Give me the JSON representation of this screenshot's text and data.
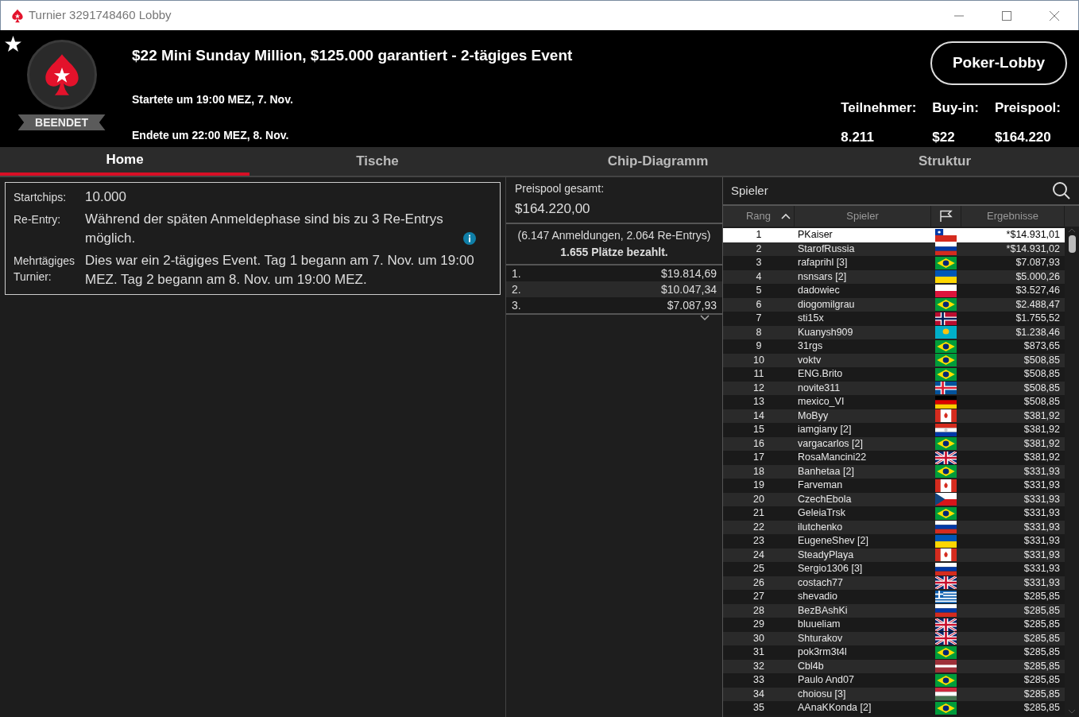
{
  "window": {
    "title": "Turnier 3291748460 Lobby"
  },
  "header": {
    "status": "BEENDET",
    "title": "$22 Mini Sunday Million, $125.000 garantiert - 2-tägiges Event",
    "started": "Startete um 19:00 MEZ, 7. Nov.",
    "ended": "Endete um 22:00 MEZ, 8. Nov.",
    "button": "Poker-Lobby",
    "stats": [
      {
        "label": "Teilnehmer:",
        "value": "8.211"
      },
      {
        "label": "Buy-in:",
        "value": "$22"
      },
      {
        "label": "Preispool:",
        "value": "$164.220"
      }
    ]
  },
  "tabs": [
    {
      "label": "Home",
      "selected": true
    },
    {
      "label": "Tische",
      "selected": false
    },
    {
      "label": "Chip-Diagramm",
      "selected": false
    },
    {
      "label": "Struktur",
      "selected": false
    }
  ],
  "details": [
    {
      "label": "Startchips:",
      "value": "10.000",
      "info": false
    },
    {
      "label": "Re-Entry:",
      "value": "Während der späten Anmeldephase sind bis zu 3 Re-Entrys möglich.",
      "info": true
    },
    {
      "label": "Mehrtägiges Turnier:",
      "value": "Dies war ein 2-tägiges Event. Tag 1 begann am 7. Nov. um 19:00 MEZ. Tag 2 begann am 8. Nov. um 19:00 MEZ.",
      "info": false
    }
  ],
  "prizepool": {
    "label": "Preispool gesamt:",
    "value": "$164.220,00",
    "entries": "(6.147 Anmeldungen, 2.064 Re-Entrys)",
    "paid": "1.655 Plätze bezahlt.",
    "payouts": [
      {
        "place": "1.",
        "amount": "$19.814,69"
      },
      {
        "place": "2.",
        "amount": "$10.047,34"
      },
      {
        "place": "3.",
        "amount": "$7.087,93"
      }
    ]
  },
  "players": {
    "title": "Spieler",
    "columns": [
      {
        "label": "Rang",
        "sorted": true
      },
      {
        "label": "Spieler",
        "sorted": false
      },
      {
        "label": "Ergebnisse",
        "sorted": false
      }
    ],
    "rows": [
      {
        "rank": "1",
        "name": "PKaiser",
        "kind": "cl",
        "result": "*$14.931,01",
        "selected": true
      },
      {
        "rank": "2",
        "name": "StarofRussia",
        "kind": "ru",
        "result": "*$14.931,02",
        "selected": false
      },
      {
        "rank": "3",
        "name": "rafaprihl [3]",
        "kind": "br",
        "result": "$7.087,93",
        "selected": false
      },
      {
        "rank": "4",
        "name": "nsnsars [2]",
        "kind": "ua",
        "result": "$5.000,26",
        "selected": false
      },
      {
        "rank": "5",
        "name": "dadowiec",
        "kind": "pl",
        "result": "$3.527,46",
        "selected": false
      },
      {
        "rank": "6",
        "name": "diogomilgrau",
        "kind": "br",
        "result": "$2.488,47",
        "selected": false
      },
      {
        "rank": "7",
        "name": "sti15x",
        "kind": "no",
        "result": "$1.755,52",
        "selected": false
      },
      {
        "rank": "8",
        "name": "Kuanysh909",
        "kind": "kz",
        "result": "$1.238,46",
        "selected": false
      },
      {
        "rank": "9",
        "name": "31rgs",
        "kind": "br",
        "result": "$873,65",
        "selected": false
      },
      {
        "rank": "10",
        "name": "voktv",
        "kind": "br",
        "result": "$508,85",
        "selected": false
      },
      {
        "rank": "11",
        "name": "ENG.Brito",
        "kind": "br",
        "result": "$508,85",
        "selected": false
      },
      {
        "rank": "12",
        "name": "novite311",
        "kind": "is",
        "result": "$508,85",
        "selected": false
      },
      {
        "rank": "13",
        "name": "mexico_VI",
        "kind": "de",
        "result": "$508,85",
        "selected": false
      },
      {
        "rank": "14",
        "name": "MoByy",
        "kind": "ca",
        "result": "$381,92",
        "selected": false
      },
      {
        "rank": "15",
        "name": "iamgiany [2]",
        "kind": "py",
        "result": "$381,92",
        "selected": false
      },
      {
        "rank": "16",
        "name": "vargacarlos [2]",
        "kind": "br",
        "result": "$381,92",
        "selected": false
      },
      {
        "rank": "17",
        "name": "RosaMancini22",
        "kind": "gb",
        "result": "$381,92",
        "selected": false
      },
      {
        "rank": "18",
        "name": "Banhetaa [2]",
        "kind": "br",
        "result": "$331,93",
        "selected": false
      },
      {
        "rank": "19",
        "name": "Farveman",
        "kind": "ca",
        "result": "$331,93",
        "selected": false
      },
      {
        "rank": "20",
        "name": "CzechEbola",
        "kind": "cz",
        "result": "$331,93",
        "selected": false
      },
      {
        "rank": "21",
        "name": "GeleiaTrsk",
        "kind": "br",
        "result": "$331,93",
        "selected": false
      },
      {
        "rank": "22",
        "name": "ilutchenko",
        "kind": "ru",
        "result": "$331,93",
        "selected": false
      },
      {
        "rank": "23",
        "name": "EugeneShev [2]",
        "kind": "ua",
        "result": "$331,93",
        "selected": false
      },
      {
        "rank": "24",
        "name": "SteadyPlaya",
        "kind": "ca",
        "result": "$331,93",
        "selected": false
      },
      {
        "rank": "25",
        "name": "Sergio1306 [3]",
        "kind": "ru",
        "result": "$331,93",
        "selected": false
      },
      {
        "rank": "26",
        "name": "costach77",
        "kind": "gb",
        "result": "$331,93",
        "selected": false
      },
      {
        "rank": "27",
        "name": "shevadio",
        "kind": "gr",
        "result": "$285,85",
        "selected": false
      },
      {
        "rank": "28",
        "name": "BezBAshKi",
        "kind": "ru",
        "result": "$285,85",
        "selected": false
      },
      {
        "rank": "29",
        "name": "bluueliam",
        "kind": "gb",
        "result": "$285,85",
        "selected": false
      },
      {
        "rank": "30",
        "name": "Shturakov",
        "kind": "gb",
        "result": "$285,85",
        "selected": false
      },
      {
        "rank": "31",
        "name": "pok3rm3t4l",
        "kind": "br",
        "result": "$285,85",
        "selected": false
      },
      {
        "rank": "32",
        "name": "Cbl4b",
        "kind": "lv",
        "result": "$285,85",
        "selected": false
      },
      {
        "rank": "33",
        "name": "Paulo And07",
        "kind": "br",
        "result": "$285,85",
        "selected": false
      },
      {
        "rank": "34",
        "name": "choiosu [3]",
        "kind": "hu",
        "result": "$285,85",
        "selected": false
      },
      {
        "rank": "35",
        "name": "AAnaKKonda [2]",
        "kind": "br",
        "result": "$285,85",
        "selected": false
      }
    ]
  }
}
